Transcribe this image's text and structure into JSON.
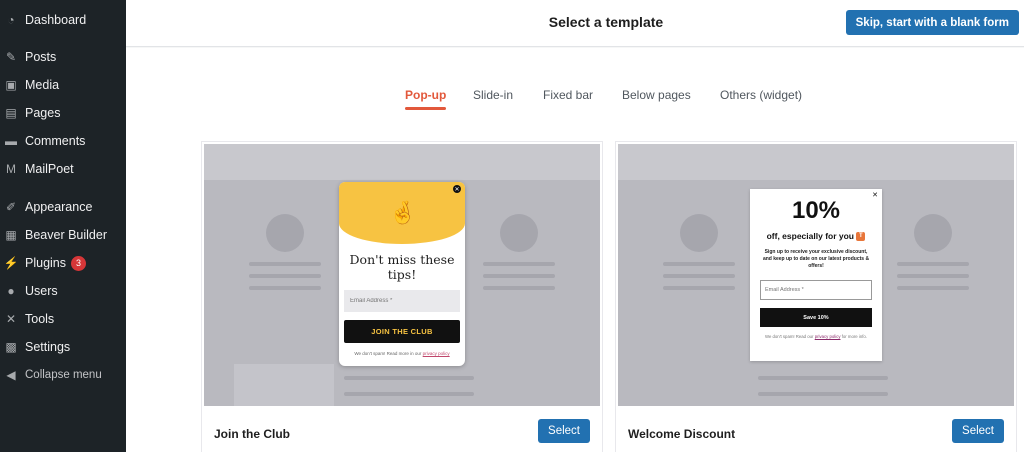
{
  "sidebar": {
    "items": [
      {
        "label": "Dashboard",
        "icon": "dashboard-icon"
      },
      {
        "label": "Posts",
        "icon": "pin-icon"
      },
      {
        "label": "Media",
        "icon": "media-icon"
      },
      {
        "label": "Pages",
        "icon": "pages-icon"
      },
      {
        "label": "Comments",
        "icon": "comment-icon"
      },
      {
        "label": "MailPoet",
        "icon": "mailpoet-icon"
      },
      {
        "label": "Appearance",
        "icon": "brush-icon"
      },
      {
        "label": "Beaver Builder",
        "icon": "layout-icon"
      },
      {
        "label": "Plugins",
        "icon": "plug-icon",
        "badge": "3"
      },
      {
        "label": "Users",
        "icon": "user-icon"
      },
      {
        "label": "Tools",
        "icon": "wrench-icon"
      },
      {
        "label": "Settings",
        "icon": "settings-icon"
      },
      {
        "label": "Collapse menu",
        "icon": "collapse-icon"
      }
    ]
  },
  "header": {
    "title": "Select a template",
    "skip_label": "Skip, start with a blank form"
  },
  "tabs": [
    "Pop-up",
    "Slide-in",
    "Fixed bar",
    "Below pages",
    "Others (widget)"
  ],
  "active_tab": "Pop-up",
  "templates": [
    {
      "name": "Join the Club",
      "select_label": "Select",
      "popup": {
        "heading": "Don't miss these tips!",
        "input_placeholder": "Email Address *",
        "button": "JOIN THE CLUB",
        "note": "We don't spam! Read more in our",
        "note_link": "privacy policy"
      }
    },
    {
      "name": "Welcome Discount",
      "select_label": "Select",
      "popup": {
        "big": "10%",
        "sub": "off, especially for you",
        "desc": "Sign up to receive your exclusive discount, and keep up to date on our latest products & offers!",
        "input_placeholder": "Email Address *",
        "button": "Save 10%",
        "note": "We don't spam! Read our",
        "note_link": "privacy policy",
        "note_end": "for more info."
      }
    }
  ],
  "colors": {
    "sidebar_bg": "#1d2327",
    "accent_blue": "#2271b1",
    "tab_active": "#e2583b",
    "popup_yellow": "#f7c342"
  }
}
